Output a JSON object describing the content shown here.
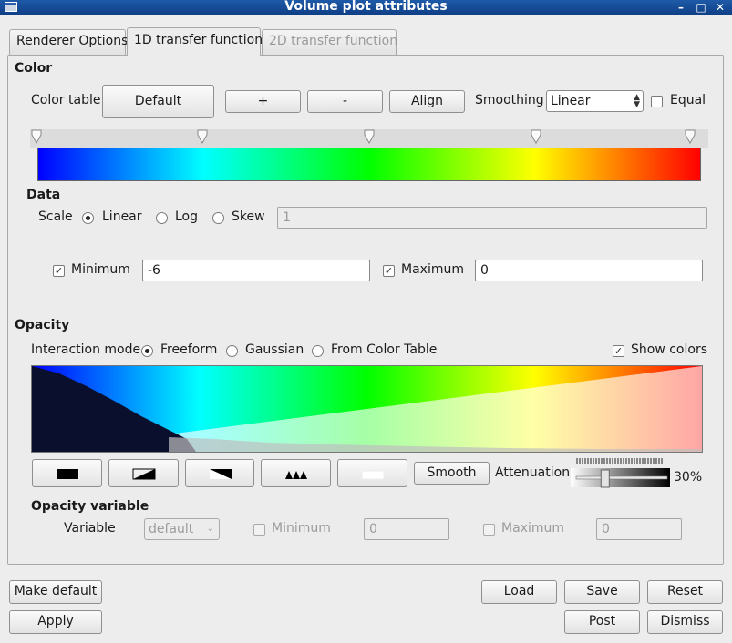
{
  "window": {
    "title": "Volume plot attributes"
  },
  "tabs": [
    {
      "label": "Renderer Options",
      "state": "normal"
    },
    {
      "label": "1D transfer function",
      "state": "active"
    },
    {
      "label": "2D transfer function",
      "state": "disabled"
    }
  ],
  "color": {
    "section_title": "Color",
    "color_table_label": "Color table",
    "color_table_button": "Default",
    "plus_button": "+",
    "minus_button": "-",
    "align_button": "Align",
    "smoothing_label": "Smoothing",
    "smoothing_value": "Linear",
    "equal_label": "Equal",
    "equal_checked": false,
    "colorbar_stops": [
      "#0000ff",
      "#00ffff",
      "#00ff00",
      "#ffff00",
      "#ff0000"
    ]
  },
  "data": {
    "section_title": "Data",
    "scale_label": "Scale",
    "scale_options": [
      "Linear",
      "Log",
      "Skew"
    ],
    "scale_selected": "Linear",
    "skew_value": "1",
    "minimum_label": "Minimum",
    "minimum_checked": true,
    "minimum_value": "-6",
    "maximum_label": "Maximum",
    "maximum_checked": true,
    "maximum_value": "0"
  },
  "opacity": {
    "section_title": "Opacity",
    "interaction_mode_label": "Interaction mode",
    "modes": [
      "Freeform",
      "Gaussian",
      "From Color Table"
    ],
    "mode_selected": "Freeform",
    "show_colors_label": "Show colors",
    "show_colors_checked": true,
    "shape_buttons": [
      "flat-icon",
      "ramp-up-icon",
      "ramp-down-icon",
      "bumps-icon",
      "zero-icon"
    ],
    "smooth_button": "Smooth",
    "attenuation_label": "Attenuation",
    "attenuation_value": "30%",
    "attenuation_level": 0.3
  },
  "opacity_variable": {
    "section_title": "Opacity variable",
    "variable_label": "Variable",
    "variable_value": "default",
    "minimum_label": "Minimum",
    "minimum_value": "0",
    "maximum_label": "Maximum",
    "maximum_value": "0"
  },
  "footer": {
    "make_default": "Make default",
    "load": "Load",
    "save": "Save",
    "reset": "Reset",
    "apply": "Apply",
    "post": "Post",
    "dismiss": "Dismiss"
  }
}
